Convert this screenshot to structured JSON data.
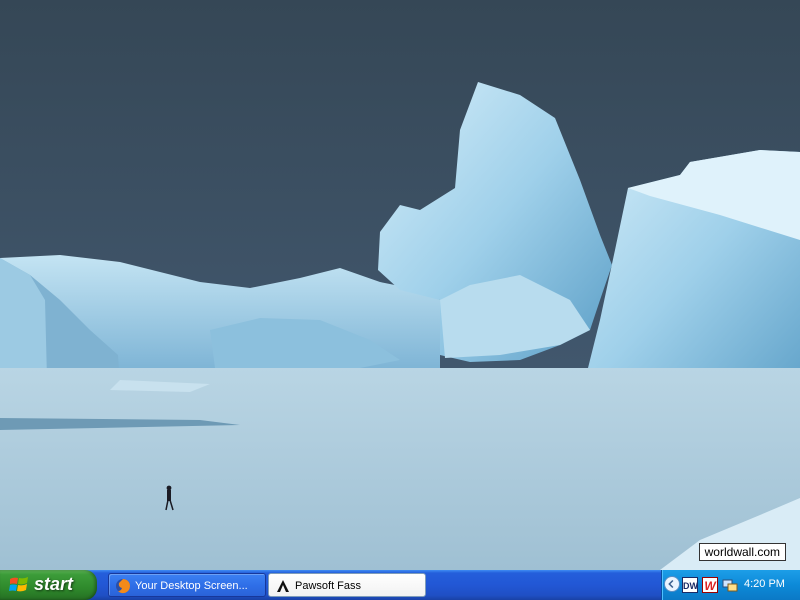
{
  "desktop": {
    "wallpaper_watermark": "worldwall.com"
  },
  "taskbar": {
    "start_label": "start",
    "tasks": [
      {
        "label": "Your Desktop Screen...",
        "icon": "firefox-icon",
        "active": false
      },
      {
        "label": "Pawsoft Fass",
        "icon": "pawsoft-icon",
        "active": true
      }
    ],
    "tray": {
      "icons": [
        "dw-icon",
        "w-icon",
        "network-icon"
      ],
      "dw_text": "DW",
      "w_text": "W",
      "clock": "4:20 PM"
    }
  },
  "colors": {
    "sky": "#3c4e5c",
    "ice": "#a8d2ea",
    "taskbar_blue": "#245edb",
    "start_green": "#3c9c39",
    "tray_blue": "#0d8ad8"
  }
}
